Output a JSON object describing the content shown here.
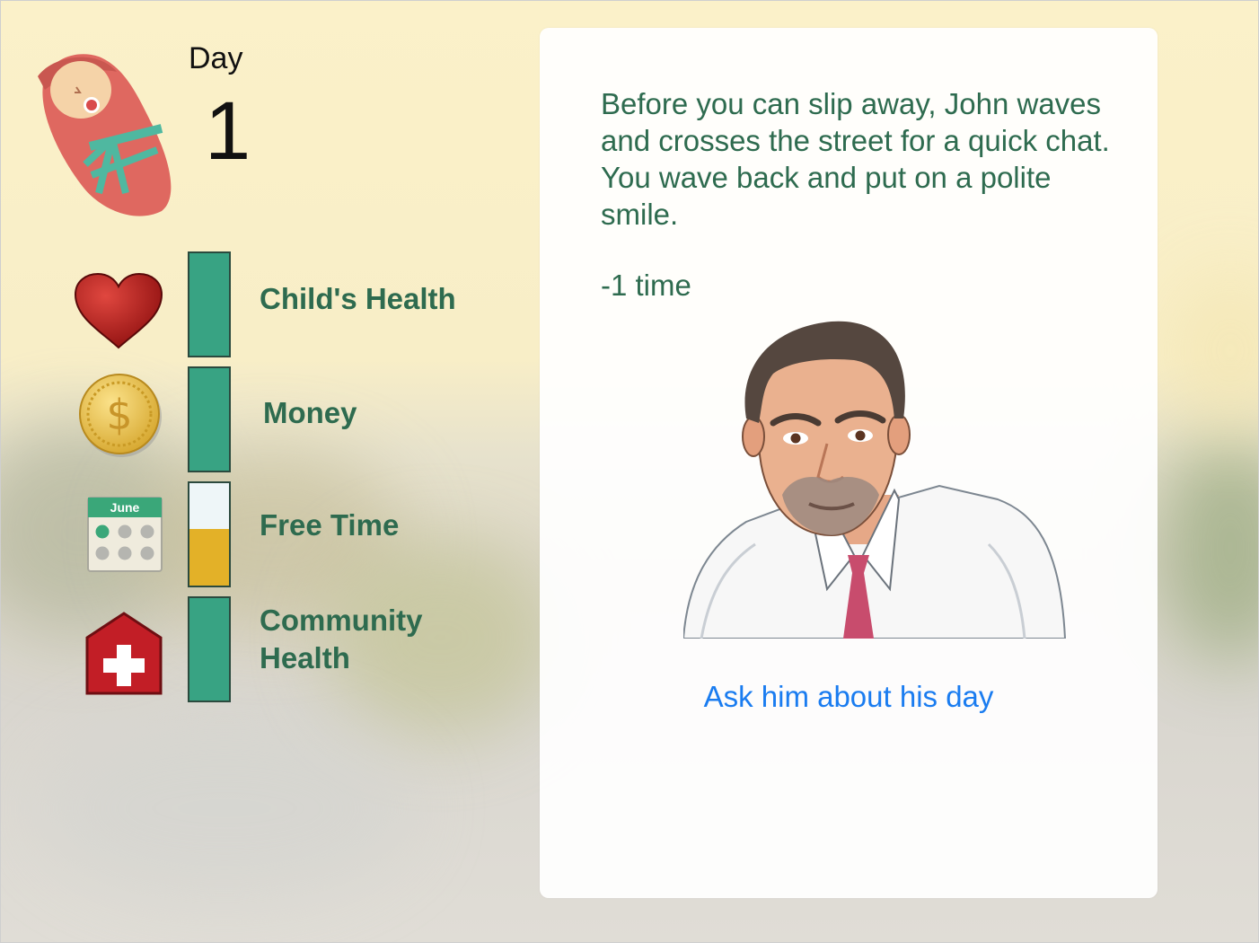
{
  "header": {
    "day_label": "Day",
    "day_number": "1"
  },
  "stats": [
    {
      "label": "Child's Health",
      "icon": "heart-icon",
      "level": 1.0,
      "fill_color": "#38a383"
    },
    {
      "label": "Money",
      "icon": "coin-icon",
      "level": 1.0,
      "fill_color": "#38a383"
    },
    {
      "label": "Free Time",
      "icon": "calendar-icon",
      "level": 0.55,
      "fill_color": "#e3b128"
    },
    {
      "label": "Community Health",
      "label_line1": "Community",
      "label_line2": "Health",
      "icon": "hospital-icon",
      "level": 1.0,
      "fill_color": "#38a383"
    }
  ],
  "calendar": {
    "month": "June"
  },
  "card": {
    "text": "Before you can slip away, John waves and crosses the street for a quick chat. You wave back and put on a polite smile.",
    "cost": "-1 time",
    "choice": "Ask him about his day"
  },
  "colors": {
    "text_green": "#2e6b4f",
    "bar_green": "#38a383",
    "bar_yellow": "#e3b128",
    "link_blue": "#1a7cf0"
  }
}
